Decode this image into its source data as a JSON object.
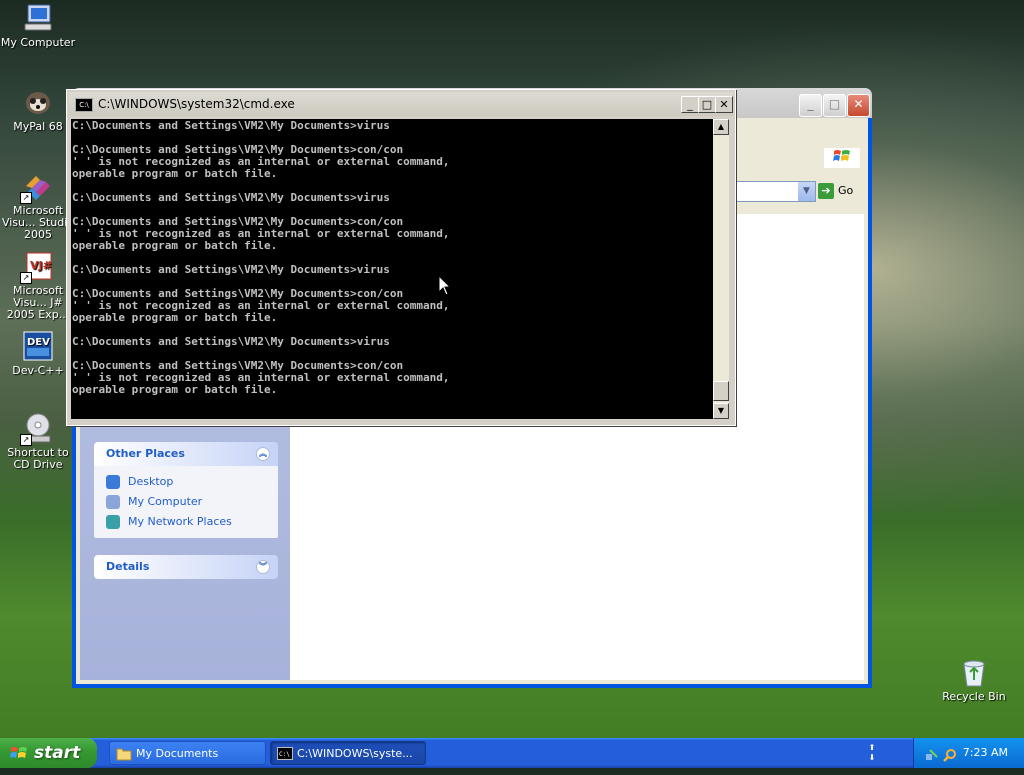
{
  "desktop": {
    "icons": [
      {
        "label": "My Computer",
        "icon": "my-computer-icon"
      },
      {
        "label": "MyPal 68",
        "icon": "mypal-icon"
      },
      {
        "label": "Microsoft Visu... Studio 2005",
        "icon": "visual-studio-icon"
      },
      {
        "label": "Microsoft Visu... J# 2005 Exp...",
        "icon": "vj-sharp-icon"
      },
      {
        "label": "Dev-C++",
        "icon": "dev-cpp-icon"
      },
      {
        "label": "Shortcut to CD Drive",
        "icon": "cd-drive-icon"
      },
      {
        "label": "Recycle Bin",
        "icon": "recycle-bin-icon"
      }
    ]
  },
  "explorer": {
    "go_label": "Go",
    "other_places": {
      "title": "Other Places",
      "items": [
        "Desktop",
        "My Computer",
        "My Network Places"
      ]
    },
    "details": {
      "title": "Details"
    }
  },
  "cmd": {
    "title": "C:\\WINDOWS\\system32\\cmd.exe",
    "icon_text": "C:\\",
    "lines": [
      "C:\\Documents and Settings\\VM2\\My Documents>virus",
      "",
      "C:\\Documents and Settings\\VM2\\My Documents>con/con",
      "' ' is not recognized as an internal or external command,",
      "operable program or batch file.",
      "",
      "C:\\Documents and Settings\\VM2\\My Documents>virus",
      "",
      "C:\\Documents and Settings\\VM2\\My Documents>con/con",
      "' ' is not recognized as an internal or external command,",
      "operable program or batch file.",
      "",
      "C:\\Documents and Settings\\VM2\\My Documents>virus",
      "",
      "C:\\Documents and Settings\\VM2\\My Documents>con/con",
      "' ' is not recognized as an internal or external command,",
      "operable program or batch file.",
      "",
      "C:\\Documents and Settings\\VM2\\My Documents>virus",
      "",
      "C:\\Documents and Settings\\VM2\\My Documents>con/con",
      "' ' is not recognized as an internal or external command,",
      "operable program or batch file."
    ]
  },
  "taskbar": {
    "start_label": "start",
    "tasks": [
      {
        "label": "My Documents",
        "icon": "folder-icon"
      },
      {
        "label": "C:\\WINDOWS\\syste...",
        "icon": "cmd-icon"
      }
    ],
    "clock": "7:23 AM"
  },
  "colors": {
    "console_bg": "#000000",
    "console_fg": "#c0c0c0",
    "taskbar_blue": "#245edb",
    "start_green": "#379a33",
    "link_blue": "#215dc6"
  }
}
